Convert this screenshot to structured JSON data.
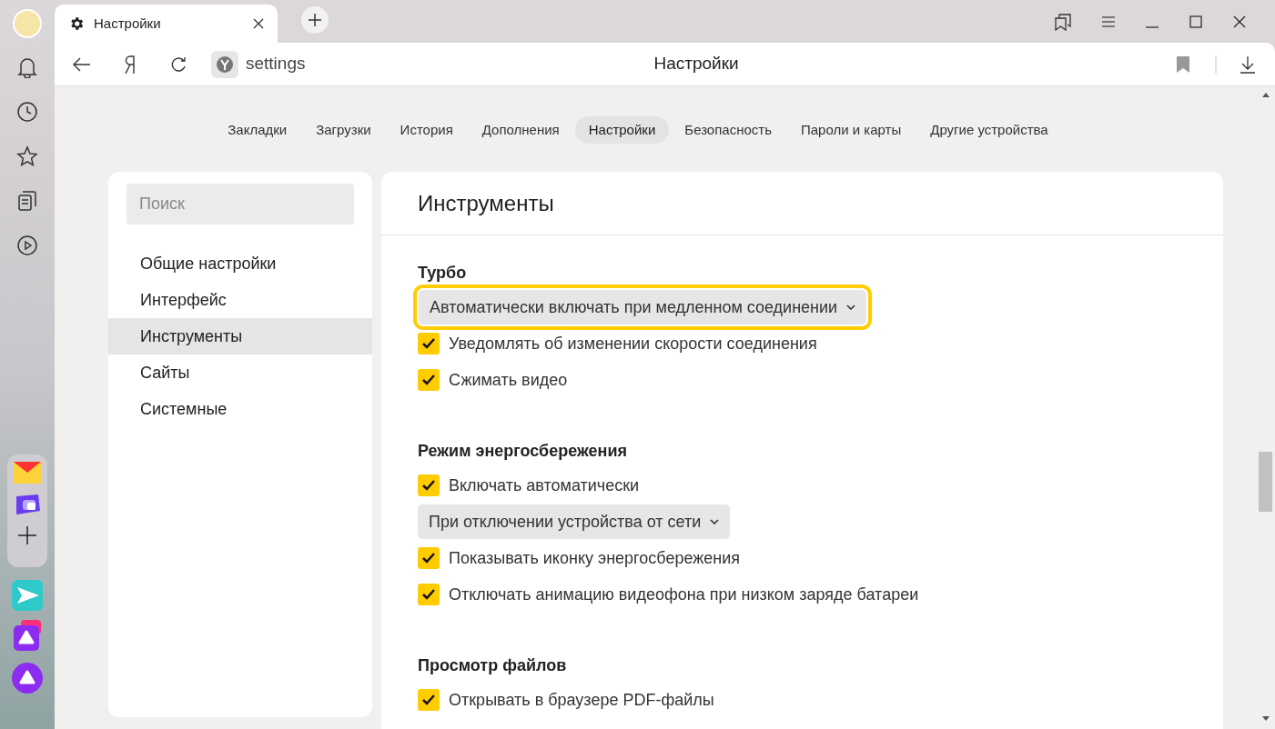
{
  "tab": {
    "title": "Настройки"
  },
  "address": {
    "url": "settings",
    "page_title": "Настройки"
  },
  "nav": [
    {
      "label": "Закладки",
      "selected": false
    },
    {
      "label": "Загрузки",
      "selected": false
    },
    {
      "label": "История",
      "selected": false
    },
    {
      "label": "Дополнения",
      "selected": false
    },
    {
      "label": "Настройки",
      "selected": true
    },
    {
      "label": "Безопасность",
      "selected": false
    },
    {
      "label": "Пароли и карты",
      "selected": false
    },
    {
      "label": "Другие устройства",
      "selected": false
    }
  ],
  "sidebar": {
    "search_placeholder": "Поиск",
    "items": [
      {
        "label": "Общие настройки",
        "selected": false
      },
      {
        "label": "Интерфейс",
        "selected": false
      },
      {
        "label": "Инструменты",
        "selected": true
      },
      {
        "label": "Сайты",
        "selected": false
      },
      {
        "label": "Системные",
        "selected": false
      }
    ]
  },
  "panel": {
    "title": "Инструменты",
    "sections": [
      {
        "title": "Турбо",
        "items": [
          {
            "kind": "select",
            "value": "Автоматически включать при медленном соединении",
            "highlighted": true
          },
          {
            "kind": "checkbox",
            "label": "Уведомлять об изменении скорости соединения",
            "checked": true
          },
          {
            "kind": "checkbox",
            "label": "Сжимать видео",
            "checked": true
          }
        ]
      },
      {
        "title": "Режим энергосбережения",
        "items": [
          {
            "kind": "checkbox",
            "label": "Включать автоматически",
            "checked": true
          },
          {
            "kind": "select",
            "value": "При отключении устройства от сети",
            "highlighted": false
          },
          {
            "kind": "checkbox",
            "label": "Показывать иконку энергосбережения",
            "checked": true
          },
          {
            "kind": "checkbox",
            "label": "Отключать анимацию видеофона при низком заряде батареи",
            "checked": true
          }
        ]
      },
      {
        "title": "Просмотр файлов",
        "items": [
          {
            "kind": "checkbox",
            "label": "Открывать в браузере PDF-файлы",
            "checked": true
          }
        ]
      }
    ]
  }
}
